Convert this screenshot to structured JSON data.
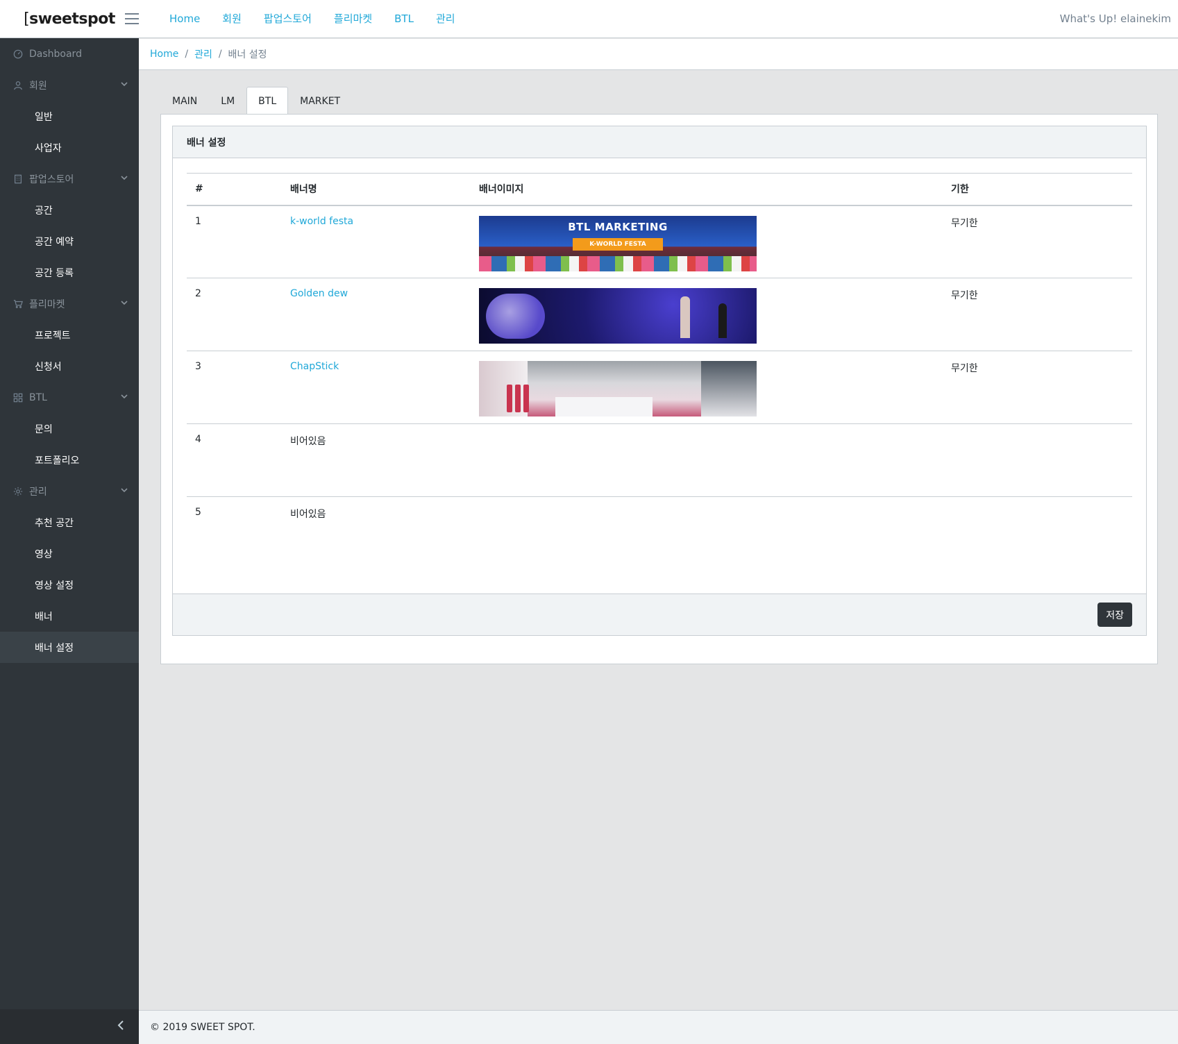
{
  "header": {
    "brand_bracket": "[",
    "brand_text": "sweetspot",
    "nav": [
      "Home",
      "회원",
      "팝업스토어",
      "플리마켓",
      "BTL",
      "관리"
    ],
    "greeting": "What's Up! elainekim"
  },
  "sidebar": {
    "items": [
      {
        "label": "Dashboard",
        "icon": "speedometer-icon",
        "type": "title"
      },
      {
        "label": "회원",
        "icon": "user-icon",
        "type": "group"
      },
      {
        "label": "일반",
        "type": "sub"
      },
      {
        "label": "사업자",
        "type": "sub"
      },
      {
        "label": "팝업스토어",
        "icon": "building-icon",
        "type": "group"
      },
      {
        "label": "공간",
        "type": "sub"
      },
      {
        "label": "공간 예약",
        "type": "sub"
      },
      {
        "label": "공간 등록",
        "type": "sub"
      },
      {
        "label": "플리마켓",
        "icon": "cart-icon",
        "type": "group"
      },
      {
        "label": "프로젝트",
        "type": "sub"
      },
      {
        "label": "신청서",
        "type": "sub"
      },
      {
        "label": "BTL",
        "icon": "grid-icon",
        "type": "group"
      },
      {
        "label": "문의",
        "type": "sub"
      },
      {
        "label": "포트폴리오",
        "type": "sub"
      },
      {
        "label": "관리",
        "icon": "gear-icon",
        "type": "group"
      },
      {
        "label": "추천 공간",
        "type": "sub"
      },
      {
        "label": "영상",
        "type": "sub"
      },
      {
        "label": "영상 설정",
        "type": "sub"
      },
      {
        "label": "배너",
        "type": "sub"
      },
      {
        "label": "배너 설정",
        "type": "sub",
        "active": true
      }
    ]
  },
  "breadcrumb": {
    "home": "Home",
    "section": "관리",
    "current": "배너 설정",
    "separator": "/"
  },
  "tabs": [
    {
      "label": "MAIN",
      "active": false
    },
    {
      "label": "LM",
      "active": false
    },
    {
      "label": "BTL",
      "active": true
    },
    {
      "label": "MARKET",
      "active": false
    }
  ],
  "card": {
    "title": "배너 설정",
    "columns": [
      "#",
      "배너명",
      "배너이미지",
      "기한"
    ],
    "rows": [
      {
        "num": "1",
        "name": "k-world festa",
        "has_link": true,
        "image": "k-world-festa-banner",
        "image_title": "BTL MARKETING",
        "image_sign": "K-WORLD FESTA",
        "period": "무기한"
      },
      {
        "num": "2",
        "name": "Golden dew",
        "has_link": true,
        "image": "golden-dew-banner",
        "period": "무기한"
      },
      {
        "num": "3",
        "name": "ChapStick",
        "has_link": true,
        "image": "chapstick-banner",
        "period": "무기한"
      },
      {
        "num": "4",
        "name": "비어있음",
        "has_link": false,
        "image": "",
        "period": ""
      },
      {
        "num": "5",
        "name": "비어있음",
        "has_link": false,
        "image": "",
        "period": ""
      }
    ],
    "save_label": "저장"
  },
  "footer": {
    "copyright": "© 2019 SWEET SPOT."
  },
  "colors": {
    "accent": "#20a8d8",
    "sidebar_bg": "#2f353a",
    "button_dark": "#2f353a"
  }
}
